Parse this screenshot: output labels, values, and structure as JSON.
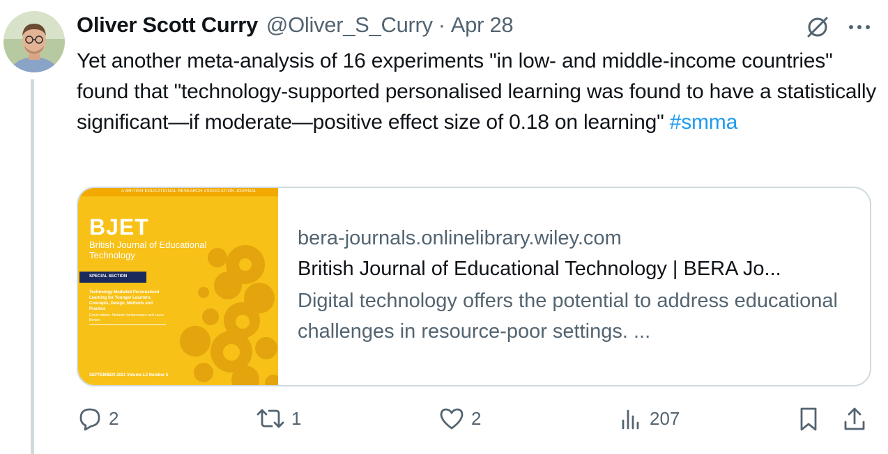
{
  "tweet": {
    "author_name": "Oliver Scott Curry",
    "handle": "@Oliver_S_Curry",
    "separator": "·",
    "date": "Apr 28",
    "text": "Yet another meta-analysis of 16 experiments \"in low- and middle-income countries\" found that \"technology-supported personalised learning was found to have a statistically significant—if moderate—positive effect size of 0.18 on learning\"",
    "hashtag": "#smma"
  },
  "card": {
    "domain": "bera-journals.onlinelibrary.wiley.com",
    "title": "British Journal of Educational Technology | BERA Jo...",
    "description": "Digital technology offers the potential to address educational challenges in resource-poor settings. ...",
    "cover": {
      "header": "A BRITISH EDUCATIONAL RESEARCH ASSOCIATION JOURNAL",
      "acronym": "BJET",
      "journal_name": "British Journal of Educational Technology",
      "section_label": "SPECIAL SECTION",
      "section_title": "Technology-Mediated Personalised Learning for Younger Learners: Concepts, Design, Methods and Practice",
      "editors": "Guest editors: Stefanie Vanbecelaere and Laura Benton",
      "issue": "SEPTEMBER 2021 Volume LII Number 5"
    }
  },
  "actions": {
    "replies": "2",
    "reposts": "1",
    "likes": "2",
    "views": "207"
  },
  "icons": {
    "replies": "reply-icon",
    "reposts": "repost-icon",
    "likes": "heart-icon",
    "views": "views-icon",
    "bookmark": "bookmark-icon",
    "share": "share-icon",
    "grok": "grok-icon",
    "more": "more-icon"
  },
  "colors": {
    "link": "#1d9bf0",
    "muted": "#536471",
    "border": "#cfd9de",
    "cover": "#f7c117"
  }
}
